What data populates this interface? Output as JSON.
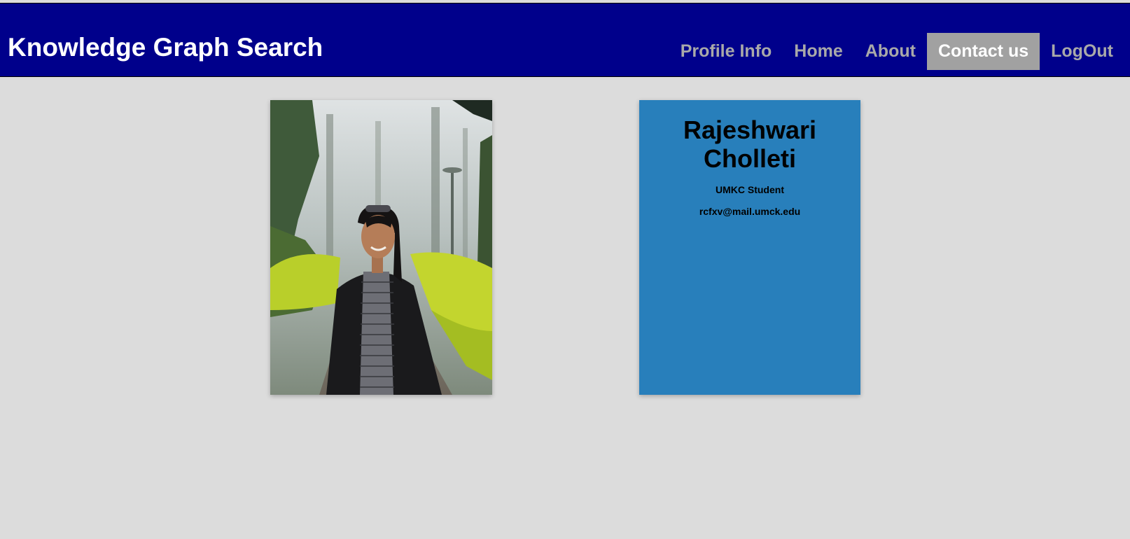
{
  "navbar": {
    "brand": "Knowledge Graph Search",
    "links": [
      {
        "label": "Profile Info",
        "active": false
      },
      {
        "label": "Home",
        "active": false
      },
      {
        "label": "About",
        "active": false
      },
      {
        "label": "Contact us",
        "active": true
      },
      {
        "label": "LogOut",
        "active": false
      }
    ]
  },
  "profile": {
    "name_line1": "Rajeshwari",
    "name_line2": "Cholleti",
    "role": "UMKC Student",
    "email": "rcfxv@mail.umck.edu"
  },
  "colors": {
    "navbar_bg": "#00008b",
    "active_tab_bg": "#a1a1a1",
    "card_bg": "#287fbb",
    "page_bg": "#dcdcdc"
  }
}
